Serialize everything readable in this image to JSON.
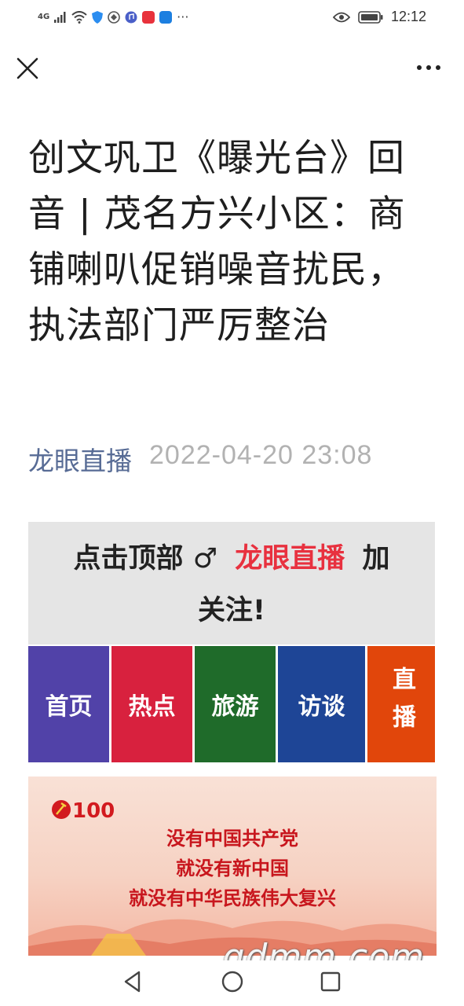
{
  "status_bar": {
    "signal": "4G",
    "time": "12:12",
    "more": "···"
  },
  "article": {
    "title": "创文巩卫《曝光台》回音 | 茂名方兴小区：商铺喇叭促销噪音扰民，执法部门严厉整治",
    "account": "龙眼直播",
    "date": "2022-04-20 23:08"
  },
  "follow_banner": {
    "prefix": "点击顶部",
    "symbol": "♂",
    "brand": "龙眼直播",
    "suffix": "加",
    "line2": "关注!"
  },
  "tiles": [
    {
      "label": "首页",
      "color": "#5142a8"
    },
    {
      "label": "热点",
      "color": "#d8213e"
    },
    {
      "label": "旅游",
      "color": "#1f6b2a"
    },
    {
      "label": "访谈",
      "color": "#1e4596"
    },
    {
      "label": "直播",
      "color": "#e1460b"
    }
  ],
  "poster": {
    "logo_number": "100",
    "slogan_lines": [
      "没有中国共产党",
      "就没有新中国",
      "就没有中华民族伟大复兴"
    ]
  },
  "watermark": "gdmm.com",
  "colors": {
    "link": "#576b95",
    "brand_red": "#e8313f",
    "banner_bg": "#e5e5e5"
  }
}
